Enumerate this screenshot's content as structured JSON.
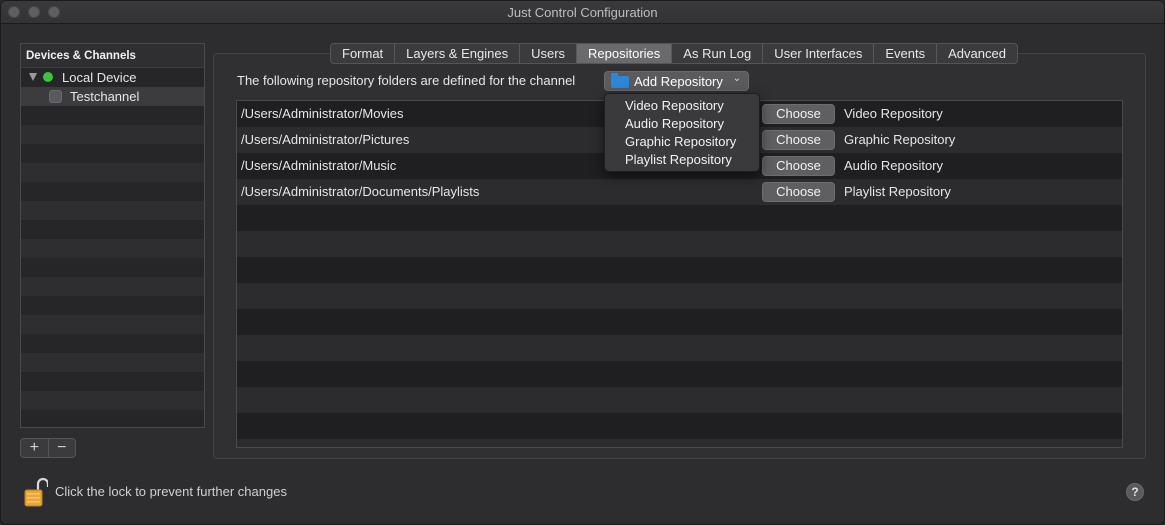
{
  "window": {
    "title": "Just Control Configuration"
  },
  "sidebar": {
    "header": "Devices & Channels",
    "device": {
      "label": "Local Device",
      "status_color": "#3cc23c"
    },
    "channel": {
      "label": "Testchannel",
      "checked": false
    },
    "add_label": "+",
    "remove_label": "−"
  },
  "tabs": [
    {
      "label": "Format",
      "active": false
    },
    {
      "label": "Layers & Engines",
      "active": false
    },
    {
      "label": "Users",
      "active": false
    },
    {
      "label": "Repositories",
      "active": true
    },
    {
      "label": "As Run Log",
      "active": false
    },
    {
      "label": "User Interfaces",
      "active": false
    },
    {
      "label": "Events",
      "active": false
    },
    {
      "label": "Advanced",
      "active": false
    }
  ],
  "repositories": {
    "intro": "The following repository folders are defined for the channel",
    "add_button": {
      "label": "Add Repository",
      "icon": "folder-icon"
    },
    "menu": [
      "Video Repository",
      "Audio Repository",
      "Graphic Repository",
      "Playlist Repository"
    ],
    "choose_label": "Choose",
    "rows": [
      {
        "path": "/Users/Administrator/Movies",
        "type": "Video Repository"
      },
      {
        "path": "/Users/Administrator/Pictures",
        "type": "Graphic Repository"
      },
      {
        "path": "/Users/Administrator/Music",
        "type": "Audio Repository"
      },
      {
        "path": "/Users/Administrator/Documents/Playlists",
        "type": "Playlist Repository"
      }
    ]
  },
  "footer": {
    "lock_text": "Click the lock to prevent further changes",
    "help_label": "?"
  },
  "colors": {
    "accent_folder": "#2f86d6",
    "active_tab": "#6a6a6c"
  }
}
